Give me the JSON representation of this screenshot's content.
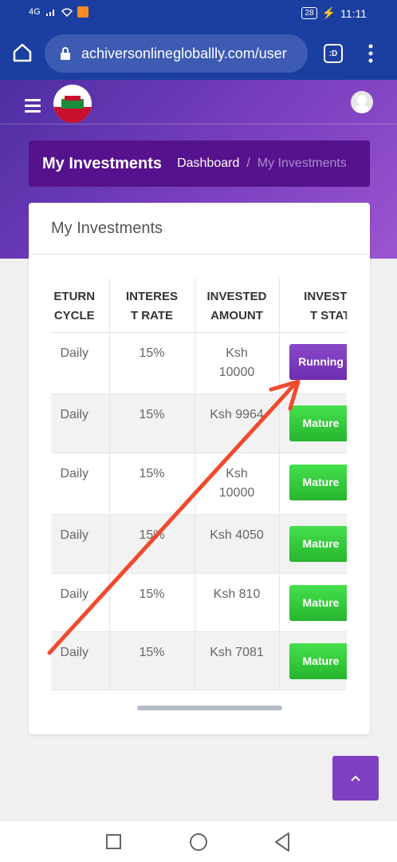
{
  "status_bar": {
    "network": "4G",
    "battery": "28",
    "time": "11:11"
  },
  "browser": {
    "url": "achiversonlinegloballly.com/user",
    "tab_count": ":D"
  },
  "colors": {
    "browser_bar": "#1b3fa0",
    "hero_start": "#4d2ea2",
    "hero_end": "#9b55cf",
    "breadcrumb_bg": "#56128c",
    "running": "#7b39bd",
    "mature": "#34c93b",
    "arrow": "#f04a2f"
  },
  "breadcrumb": {
    "title": "My Investments",
    "link": "Dashboard",
    "separator": "/",
    "current": "My Investments"
  },
  "card": {
    "title": "My Investments"
  },
  "table": {
    "headers": [
      {
        "line1": "ETURN",
        "line2": "CYCLE"
      },
      {
        "line1": "INTERES",
        "line2": "T RATE"
      },
      {
        "line1": "INVESTED",
        "line2": "AMOUNT"
      },
      {
        "line1": "INVESTME",
        "line2": "T STATU"
      }
    ],
    "rows": [
      {
        "cycle": "Daily",
        "rate": "15%",
        "amount_line1": "Ksh",
        "amount_line2": "10000",
        "status": "Running"
      },
      {
        "cycle": "Daily",
        "rate": "15%",
        "amount_line1": "Ksh 9964",
        "amount_line2": "",
        "status": "Mature"
      },
      {
        "cycle": "Daily",
        "rate": "15%",
        "amount_line1": "Ksh",
        "amount_line2": "10000",
        "status": "Mature"
      },
      {
        "cycle": "Daily",
        "rate": "15%",
        "amount_line1": "Ksh 4050",
        "amount_line2": "",
        "status": "Mature"
      },
      {
        "cycle": "Daily",
        "rate": "15%",
        "amount_line1": "Ksh 810",
        "amount_line2": "",
        "status": "Mature"
      },
      {
        "cycle": "Daily",
        "rate": "15%",
        "amount_line1": "Ksh 7081",
        "amount_line2": "",
        "status": "Mature"
      }
    ]
  },
  "scroll_top": {
    "label": "^"
  }
}
